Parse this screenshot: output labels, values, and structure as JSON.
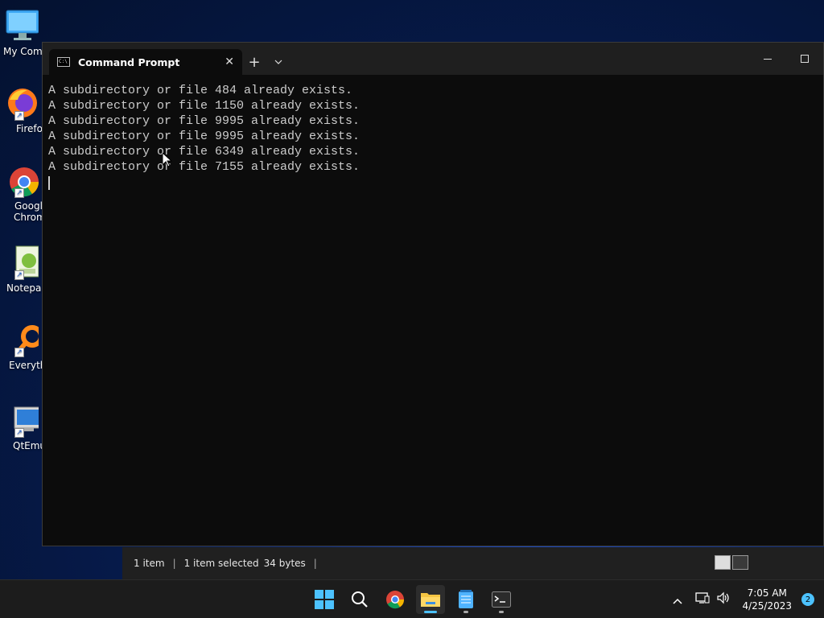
{
  "desktop": {
    "icons": [
      {
        "label": "My Comp",
        "icon": "monitor-icon"
      },
      {
        "label": "Firefo",
        "icon": "firefox-icon"
      },
      {
        "label": "Googl",
        "label2": "Chrom",
        "icon": "chrome-icon"
      },
      {
        "label": "Notepac",
        "icon": "notepad-icon"
      },
      {
        "label": "Everythi",
        "icon": "search-magnifier-icon"
      },
      {
        "label": "QtEmu",
        "icon": "computer-icon"
      }
    ]
  },
  "terminal": {
    "tab_title": "Command Prompt",
    "new_tab": "+",
    "lines": [
      "A subdirectory or file 484 already exists.",
      "A subdirectory or file 1150 already exists.",
      "A subdirectory or file 9995 already exists.",
      "A subdirectory or file 9995 already exists.",
      "A subdirectory or file 6349 already exists.",
      "A subdirectory or file 7155 already exists."
    ]
  },
  "explorer_status": {
    "items": "1 item",
    "selected": "1 item selected",
    "size": "34 bytes",
    "sep": "|"
  },
  "taskbar": {
    "time": "7:05 AM",
    "date": "4/25/2023",
    "notifications": "2",
    "accent": "#4cc2ff"
  }
}
